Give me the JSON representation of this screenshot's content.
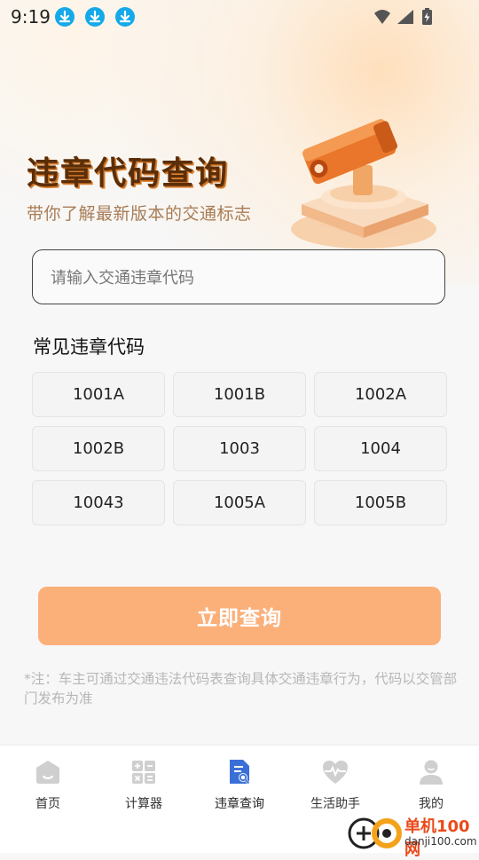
{
  "status_bar": {
    "time": "9:19",
    "left_icons": [
      "download-icon",
      "download-icon",
      "download-icon"
    ],
    "right_icons": [
      "wifi-icon",
      "signal-icon",
      "battery-charging-icon"
    ]
  },
  "hero": {
    "title": "违章代码查询",
    "subtitle": "带你了解最新版本的交通标志",
    "illustration": "traffic-camera-illustration"
  },
  "search": {
    "placeholder": "请输入交通违章代码",
    "value": ""
  },
  "common_codes": {
    "title": "常见违章代码",
    "items": [
      "1001A",
      "1001B",
      "1002A",
      "1002B",
      "1003",
      "1004",
      "10043",
      "1005A",
      "1005B"
    ]
  },
  "query_button": {
    "label": "立即查询"
  },
  "note": "*注：车主可通过交通违法代码表查询具体交通违章行为，代码以交管部门发布为准",
  "tabbar": {
    "tabs": [
      {
        "label": "首页",
        "icon": "home-icon",
        "active": false
      },
      {
        "label": "计算器",
        "icon": "calculator-icon",
        "active": false
      },
      {
        "label": "违章查询",
        "icon": "document-search-icon",
        "active": true
      },
      {
        "label": "生活助手",
        "icon": "heart-pulse-icon",
        "active": false
      },
      {
        "label": "我的",
        "icon": "user-icon",
        "active": false
      }
    ]
  },
  "watermark": {
    "name": "单机100网",
    "url": "danji100.com"
  },
  "colors": {
    "accent": "#fbb07a",
    "active_tab": "#3b6fd8",
    "inactive_icon": "#cfcfcf",
    "title_brown": "#5a2e08"
  }
}
